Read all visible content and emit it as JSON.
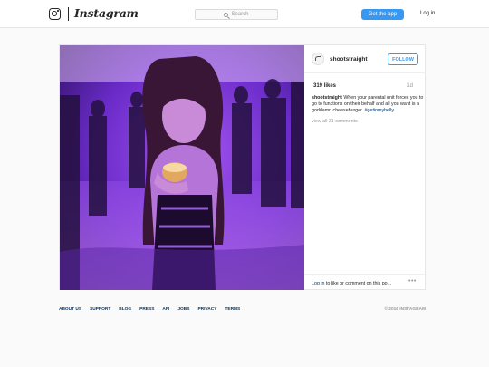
{
  "header": {
    "wordmark": "Instagram",
    "search_placeholder": "Search",
    "get_app_label": "Get the app",
    "login_label": "Log in"
  },
  "post": {
    "username": "shootstraight",
    "follow_label": "FOLLOW",
    "likes": "319 likes",
    "age": "1d",
    "caption_user": "shootstraight",
    "caption_text": " When your parental unit forces you to go to functions on their behalf and all you want is a goddamn cheeseburger. ",
    "caption_hashtag": "#getinmybelly",
    "view_all_comments": "view all 31 comments",
    "login_link": "Log in",
    "comment_prompt": " to like or comment on this po...",
    "more_options": "•••"
  },
  "footer": {
    "links": [
      "ABOUT US",
      "SUPPORT",
      "BLOG",
      "PRESS",
      "API",
      "JOBS",
      "PRIVACY",
      "TERMS"
    ],
    "copyright": "© 2016 INSTAGRAM"
  },
  "colors": {
    "accent": "#3897f0",
    "link": "#003569",
    "photo_tint": "#7b2fd6"
  },
  "icons": {
    "logo": "instagram-glyph-icon",
    "search": "search-icon",
    "more": "more-options-icon"
  }
}
